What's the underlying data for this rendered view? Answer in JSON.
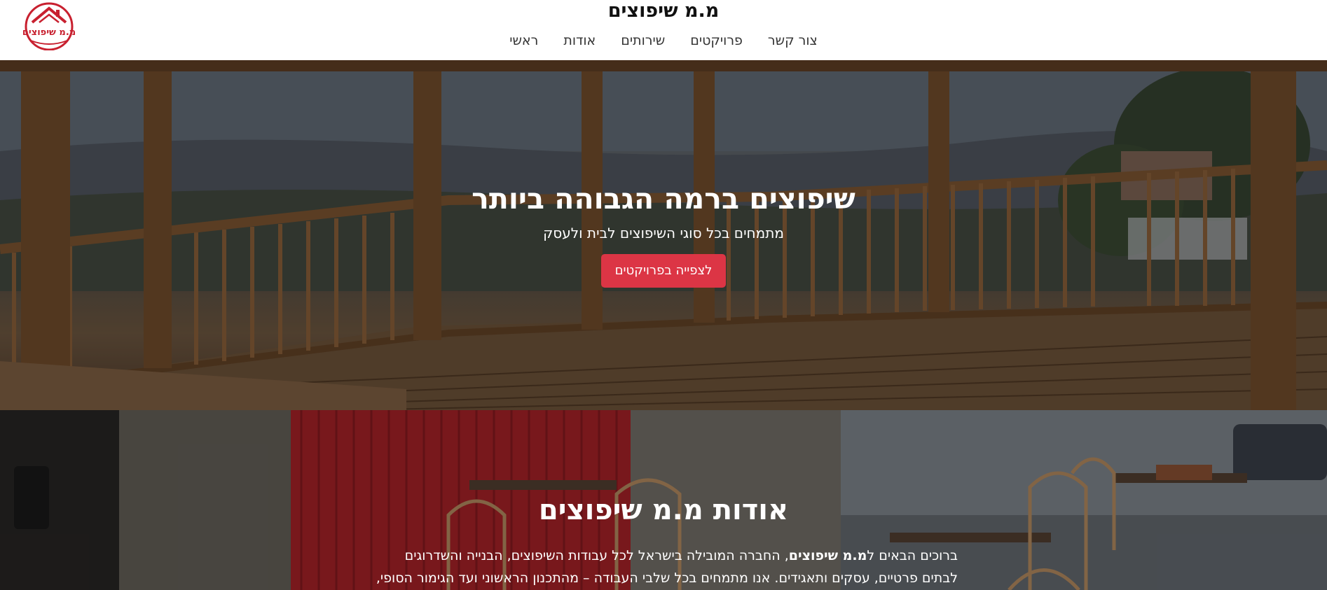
{
  "header": {
    "logo_text": "מ.מ שיפוצים",
    "site_title": "מ.מ שיפוצים",
    "nav": [
      {
        "label": "צור קשר"
      },
      {
        "label": "פרויקטים"
      },
      {
        "label": "שירותים"
      },
      {
        "label": "אודות"
      },
      {
        "label": "ראשי"
      }
    ]
  },
  "hero": {
    "title": "שיפוצים ברמה הגבוהה ביותר",
    "subtitle": "מתמחים בכל סוגי השיפוצים לבית ולעסק",
    "button_label": "לצפייה בפרויקטים"
  },
  "about": {
    "title": "אודות מ.מ שיפוצים",
    "text_prefix": "ברוכים הבאים ל",
    "text_brand": "מ.מ שיפוצים",
    "text_rest": ", החברה המובילה בישראל לכל עבודות השיפוצים, הבנייה והשדרוגים לבתים פרטיים, עסקים ותאגידים. אנו מתמחים בכל שלבי העבודה – מהתכנון הראשוני ועד הגימור הסופי,"
  },
  "colors": {
    "accent": "#dc3545",
    "logo_red": "#c8202f"
  }
}
